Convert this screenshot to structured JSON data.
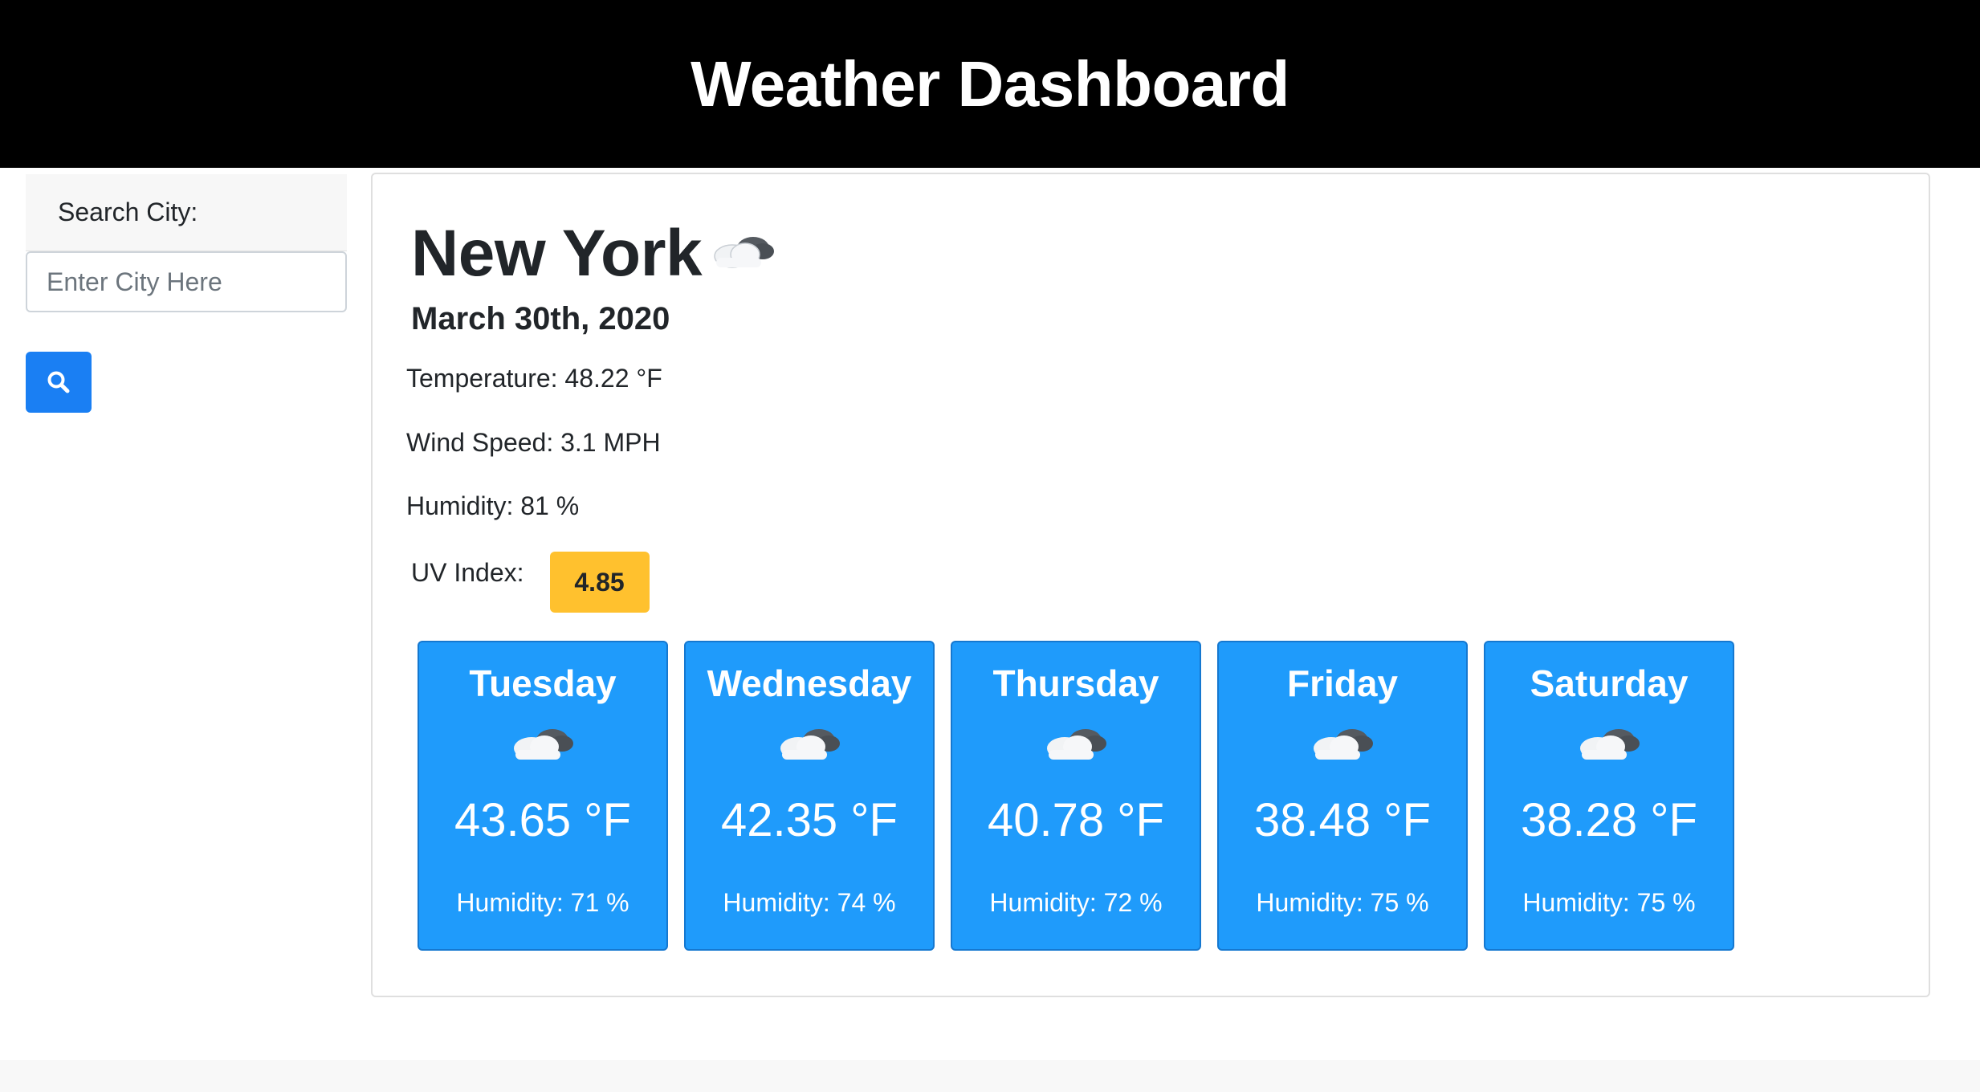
{
  "header": {
    "title": "Weather Dashboard"
  },
  "sidebar": {
    "search_label": "Search City:",
    "search_placeholder": "Enter City Here",
    "search_value": "",
    "search_button_icon": "search-icon"
  },
  "current": {
    "city": "New York",
    "icon": "cloud-icon",
    "date": "March 30th, 2020",
    "temperature": "Temperature: 48.22 °F",
    "wind": "Wind Speed: 3.1 MPH",
    "humidity": "Humidity: 81 %",
    "uv_label": "UV Index:",
    "uv_value": "4.85"
  },
  "forecast": [
    {
      "day": "Tuesday",
      "icon": "cloud-icon",
      "temp": "43.65 °F",
      "humidity": "Humidity: 71 %"
    },
    {
      "day": "Wednesday",
      "icon": "cloud-icon",
      "temp": "42.35 °F",
      "humidity": "Humidity: 74 %"
    },
    {
      "day": "Thursday",
      "icon": "cloud-icon",
      "temp": "40.78 °F",
      "humidity": "Humidity: 72 %"
    },
    {
      "day": "Friday",
      "icon": "cloud-icon",
      "temp": "38.48 °F",
      "humidity": "Humidity: 75 %"
    },
    {
      "day": "Saturday",
      "icon": "cloud-icon",
      "temp": "38.28 °F",
      "humidity": "Humidity: 75 %"
    }
  ],
  "colors": {
    "header_bg": "#000000",
    "search_button": "#1a7ff3",
    "uv_badge": "#ffc12e",
    "forecast_card": "#1f9bfb"
  }
}
